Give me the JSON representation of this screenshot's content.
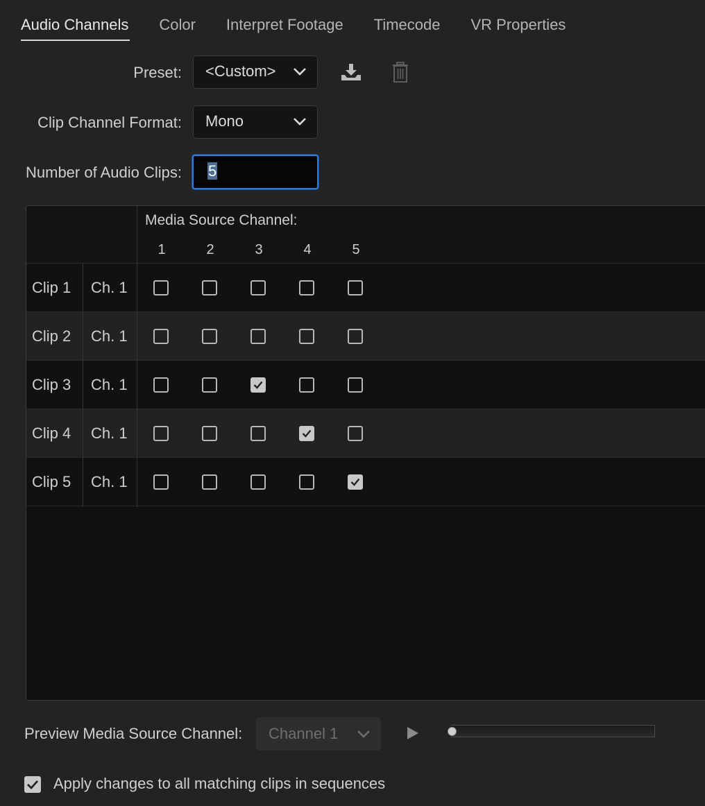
{
  "tabs": [
    {
      "label": "Audio Channels",
      "active": true
    },
    {
      "label": "Color",
      "active": false
    },
    {
      "label": "Interpret Footage",
      "active": false
    },
    {
      "label": "Timecode",
      "active": false
    },
    {
      "label": "VR Properties",
      "active": false
    }
  ],
  "preset": {
    "label": "Preset:",
    "value": "<Custom>",
    "save_icon": "download-icon",
    "delete_icon": "trash-icon"
  },
  "clip_channel_format": {
    "label": "Clip Channel Format:",
    "value": "Mono"
  },
  "num_audio_clips": {
    "label": "Number of Audio Clips:",
    "value": "5"
  },
  "matrix": {
    "header_title": "Media Source Channel:",
    "columns": [
      "1",
      "2",
      "3",
      "4",
      "5"
    ],
    "rows": [
      {
        "clip": "Clip 1",
        "channel": "Ch. 1",
        "checked": [
          false,
          false,
          false,
          false,
          false
        ]
      },
      {
        "clip": "Clip 2",
        "channel": "Ch. 1",
        "checked": [
          false,
          false,
          false,
          false,
          false
        ]
      },
      {
        "clip": "Clip 3",
        "channel": "Ch. 1",
        "checked": [
          false,
          false,
          true,
          false,
          false
        ]
      },
      {
        "clip": "Clip 4",
        "channel": "Ch. 1",
        "checked": [
          false,
          false,
          false,
          true,
          false
        ]
      },
      {
        "clip": "Clip 5",
        "channel": "Ch. 1",
        "checked": [
          false,
          false,
          false,
          false,
          true
        ]
      }
    ]
  },
  "preview": {
    "label": "Preview Media Source Channel:",
    "channel": "Channel 1",
    "play_icon": "play-icon"
  },
  "apply_all": {
    "label": "Apply changes to all matching clips in sequences",
    "checked": true
  },
  "colors": {
    "background": "#232323",
    "focus": "#2f7dd6",
    "grid": "#111111"
  }
}
